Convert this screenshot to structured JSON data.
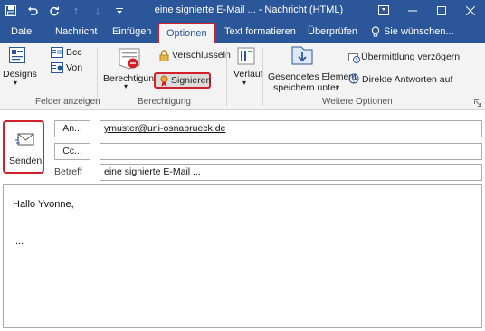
{
  "window": {
    "title": "eine signierte E-Mail ... - Nachricht (HTML)",
    "controls": [
      "restore",
      "minimize",
      "maximize",
      "close"
    ]
  },
  "tabs": [
    {
      "label": "Datei"
    },
    {
      "label": "Nachricht"
    },
    {
      "label": "Einfügen"
    },
    {
      "label": "Optionen",
      "active": true
    },
    {
      "label": "Text formatieren"
    },
    {
      "label": "Überprüfen"
    },
    {
      "label": "Sie wünschen..."
    }
  ],
  "ribbon": {
    "designs_label": "Designs",
    "bcc_label": "Bcc",
    "von_label": "Von",
    "group_felder": "Felder anzeigen",
    "berechtigung_label": "Berechtigung",
    "verschluesseln_label": "Verschlüsseln",
    "signieren_label": "Signieren",
    "group_berechtigung": "Berechtigung",
    "verlauf_label": "Verlauf",
    "gespeichert_label_1": "Gesendetes Element",
    "gespeichert_label_2": "speichern unter",
    "uebermittlung_label": "Übermittlung verzögern",
    "direkte_antworten_label": "Direkte Antworten auf",
    "group_weitere": "Weitere Optionen"
  },
  "compose": {
    "send_label": "Senden",
    "an_label": "An...",
    "cc_label": "Cc...",
    "betreff_label": "Betreff",
    "to_value": "ymuster@uni-osnabrueck.de",
    "cc_value": "",
    "subject_value": "eine signierte E-Mail ...",
    "body_line_1": "Hallo Yvonne,",
    "body_line_2": "...."
  },
  "colors": {
    "accent": "#2b579a",
    "highlight": "#d0202a"
  }
}
